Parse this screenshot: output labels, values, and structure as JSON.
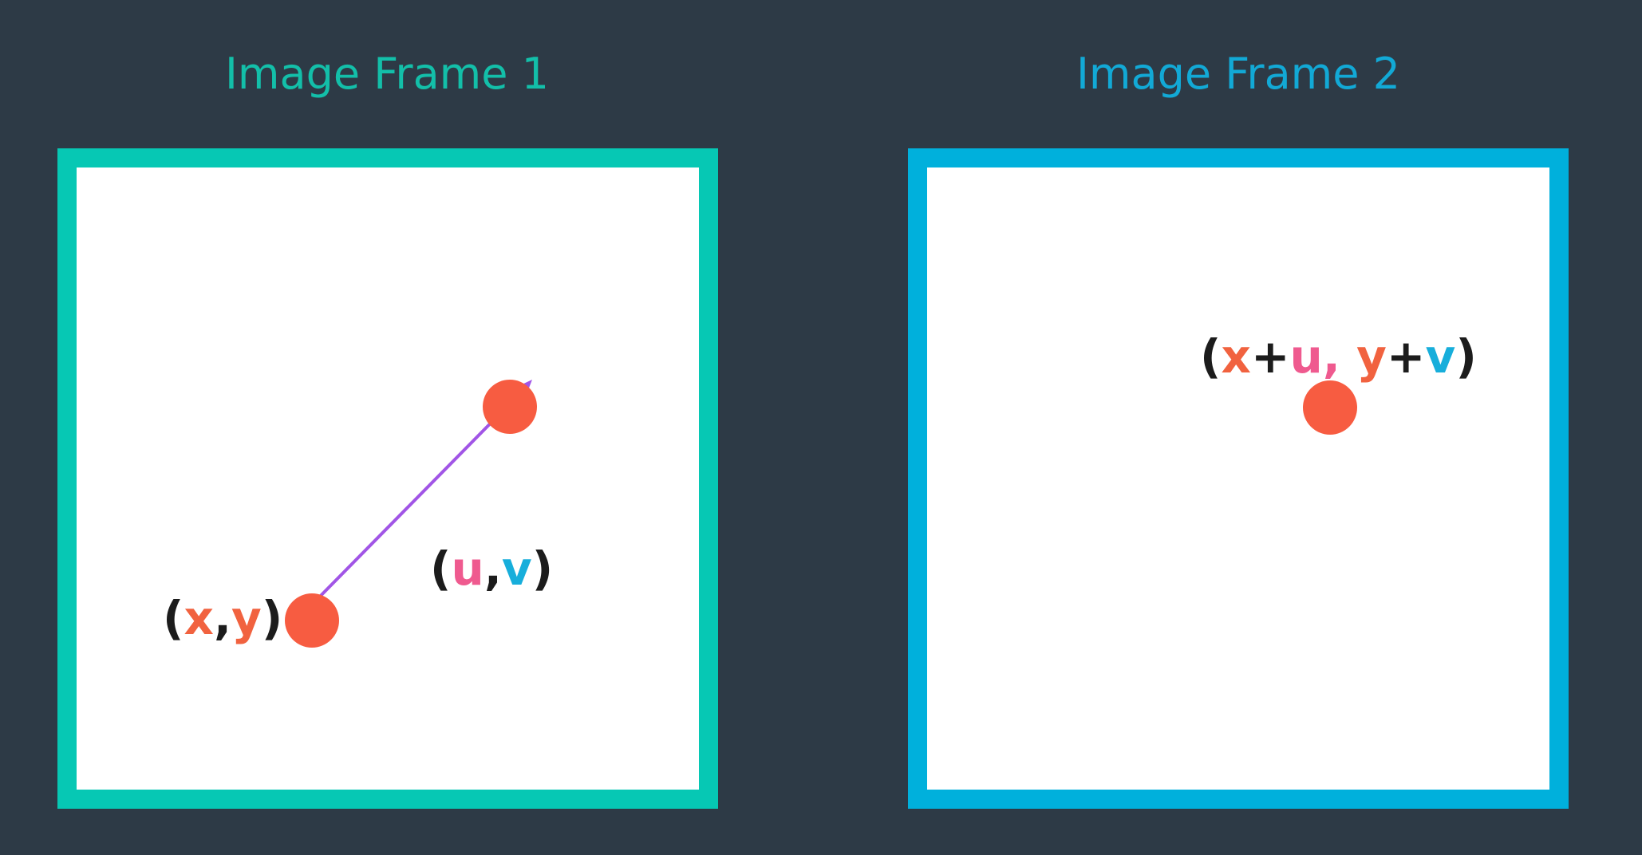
{
  "frame1": {
    "title": "Image Frame 1",
    "point_label": {
      "open": "(",
      "x": "x",
      "comma": ",",
      "y": "y",
      "close": ")"
    },
    "flow_label": {
      "open": "(",
      "u": "u",
      "comma": ",",
      "v": "v",
      "close": ")"
    }
  },
  "frame2": {
    "title": "Image Frame 2",
    "point_label": {
      "open": "(",
      "x": "x",
      "plus1": "+",
      "u": "u",
      "comma": ", ",
      "y": "y",
      "plus2": "+",
      "v": "v",
      "close": ")"
    }
  },
  "colors": {
    "background": "#2d3a46",
    "frame1_border": "#06c8b4",
    "frame2_border": "#00b0dc",
    "frame1_title": "#13bfa9",
    "frame2_title": "#12a9d6",
    "point": "#f75c41",
    "arrow": "#a155e6",
    "x_y": "#f1623f",
    "u": "#ef5a8f",
    "v": "#17aedb",
    "text_dark": "#1c1c1c"
  }
}
